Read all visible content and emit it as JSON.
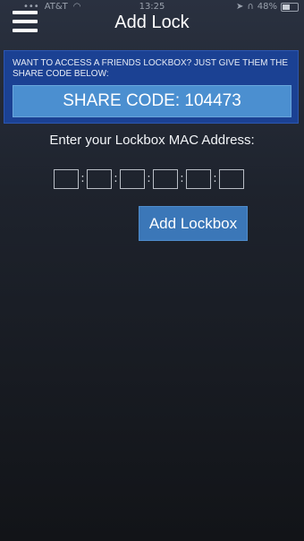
{
  "status_bar": {
    "carrier": "AT&T",
    "time": "13:25",
    "battery": "48%",
    "battery_level": 0.48
  },
  "header": {
    "title": "Add Lock"
  },
  "share": {
    "info": "WANT TO ACCESS A FRIENDS LOCKBOX? JUST GIVE THEM THE SHARE CODE BELOW:",
    "code": "SHARE CODE: 104473"
  },
  "mac": {
    "label": "Enter your Lockbox MAC Address:",
    "separator": ":",
    "fields": [
      "",
      "",
      "",
      "",
      "",
      ""
    ]
  },
  "actions": {
    "add_label": "Add Lockbox"
  },
  "colors": {
    "share_panel_bg": "#1b4193",
    "share_code_bg": "#4b8fd0",
    "button_bg": "#3b77b8"
  }
}
